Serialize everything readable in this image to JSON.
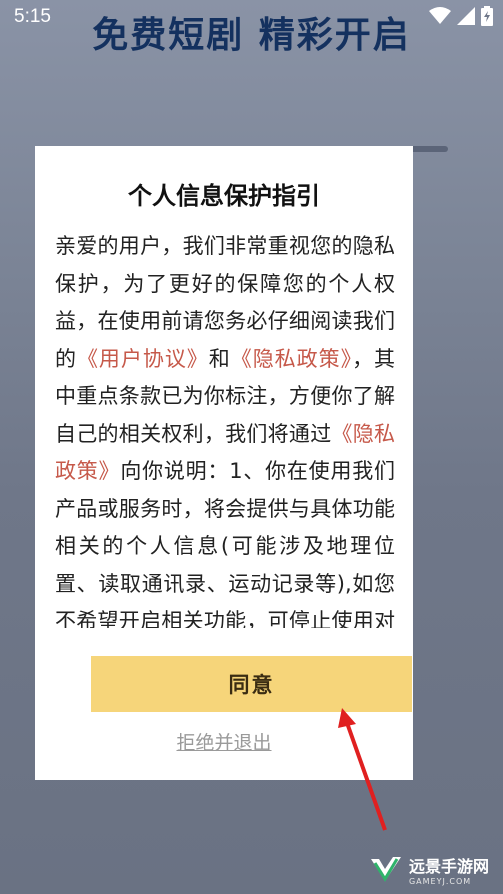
{
  "status_bar": {
    "time": "5:15"
  },
  "background": {
    "title": "免费短剧 精彩开启"
  },
  "dialog": {
    "title": "个人信息保护指引",
    "body": [
      {
        "text": "亲爱的用户，我们非常重视您的隐私保护，为了更好的保障您的个人权益，在使用前请您务必仔细阅读我们的",
        "link": false
      },
      {
        "text": "《用户协议》",
        "link": true
      },
      {
        "text": "和",
        "link": false
      },
      {
        "text": "《隐私政策》",
        "link": true
      },
      {
        "text": "，其中重点条款已为你标注，方便你了解自己的相关权利，我们将通过",
        "link": false
      },
      {
        "text": "《隐私政策》",
        "link": true
      },
      {
        "text": "向你说明：1、你在使用我们产品或服务时，将会提供与具体功能相关的个人信息(可能涉及地理位置、读取通讯录、运动记录等),如您不希望开启相关功能，可停止使用对应服务，我们将不会开启与用户",
        "link": false
      }
    ],
    "agree_label": "同意",
    "reject_label": "拒绝并退出"
  },
  "watermark": {
    "name": "远景手游网",
    "url": "GAMEYJ.COM"
  },
  "colors": {
    "link": "#c6594a",
    "button": "#f6d57a",
    "title_bg": "#14315f"
  }
}
